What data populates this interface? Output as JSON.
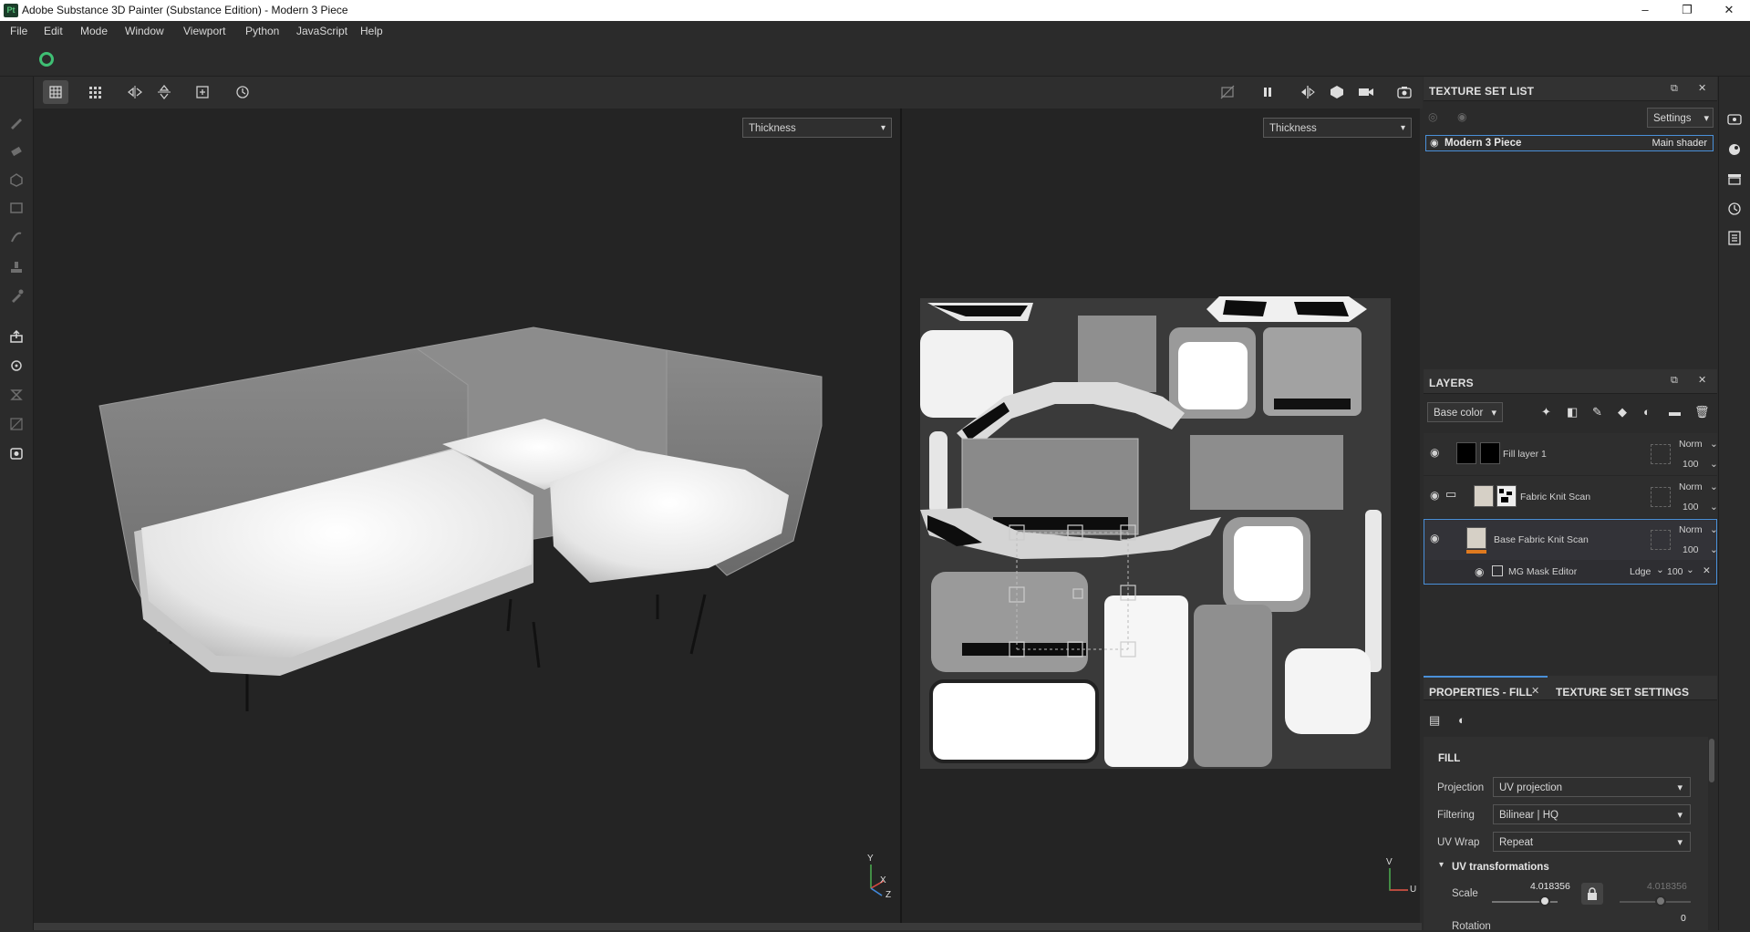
{
  "window": {
    "logo_text": "Pt",
    "title": "Adobe Substance 3D Painter (Substance Edition) - Modern 3 Piece",
    "minimize": "–",
    "maximize": "❐",
    "close": "✕"
  },
  "menu": [
    "File",
    "Edit",
    "Mode",
    "Window",
    "Viewport",
    "Python",
    "JavaScript",
    "Help"
  ],
  "viewport": {
    "left_channel": "Thickness",
    "right_channel": "Thickness",
    "axis_3d": {
      "y": "Y",
      "x": "X",
      "z": "Z"
    },
    "axis_2d": {
      "v": "V",
      "u": "U"
    }
  },
  "texture_set_list": {
    "title": "TEXTURE SET LIST",
    "settings_label": "Settings",
    "items": [
      {
        "name": "Modern 3 Piece",
        "shader": "Main shader"
      }
    ]
  },
  "layers": {
    "title": "LAYERS",
    "channel": "Base color",
    "items": [
      {
        "name": "Fill layer 1",
        "blend": "Norm",
        "opacity": "100"
      },
      {
        "name": "Fabric Knit Scan",
        "blend": "Norm",
        "opacity": "100"
      },
      {
        "name": "Base Fabric Knit Scan",
        "blend": "Norm",
        "opacity": "100"
      }
    ],
    "effect": {
      "name": "MG Mask Editor",
      "blend": "Ldge",
      "opacity": "100"
    }
  },
  "properties": {
    "tab_fill": "PROPERTIES - FILL",
    "tab_tss": "TEXTURE SET SETTINGS",
    "section": "FILL",
    "projection_label": "Projection",
    "projection_value": "UV projection",
    "filtering_label": "Filtering",
    "filtering_value": "Bilinear | HQ",
    "uvwrap_label": "UV Wrap",
    "uvwrap_value": "Repeat",
    "uv_transformations": "UV transformations",
    "scale_label": "Scale",
    "scale_value": "4.018356",
    "scale_value_2": "4.018356",
    "rotation_label": "Rotation",
    "rotation_value": "0"
  },
  "colors": {
    "accent_blue": "#4a90d9",
    "accent_green": "#3fbf74",
    "accent_orange": "#e07a1f"
  }
}
